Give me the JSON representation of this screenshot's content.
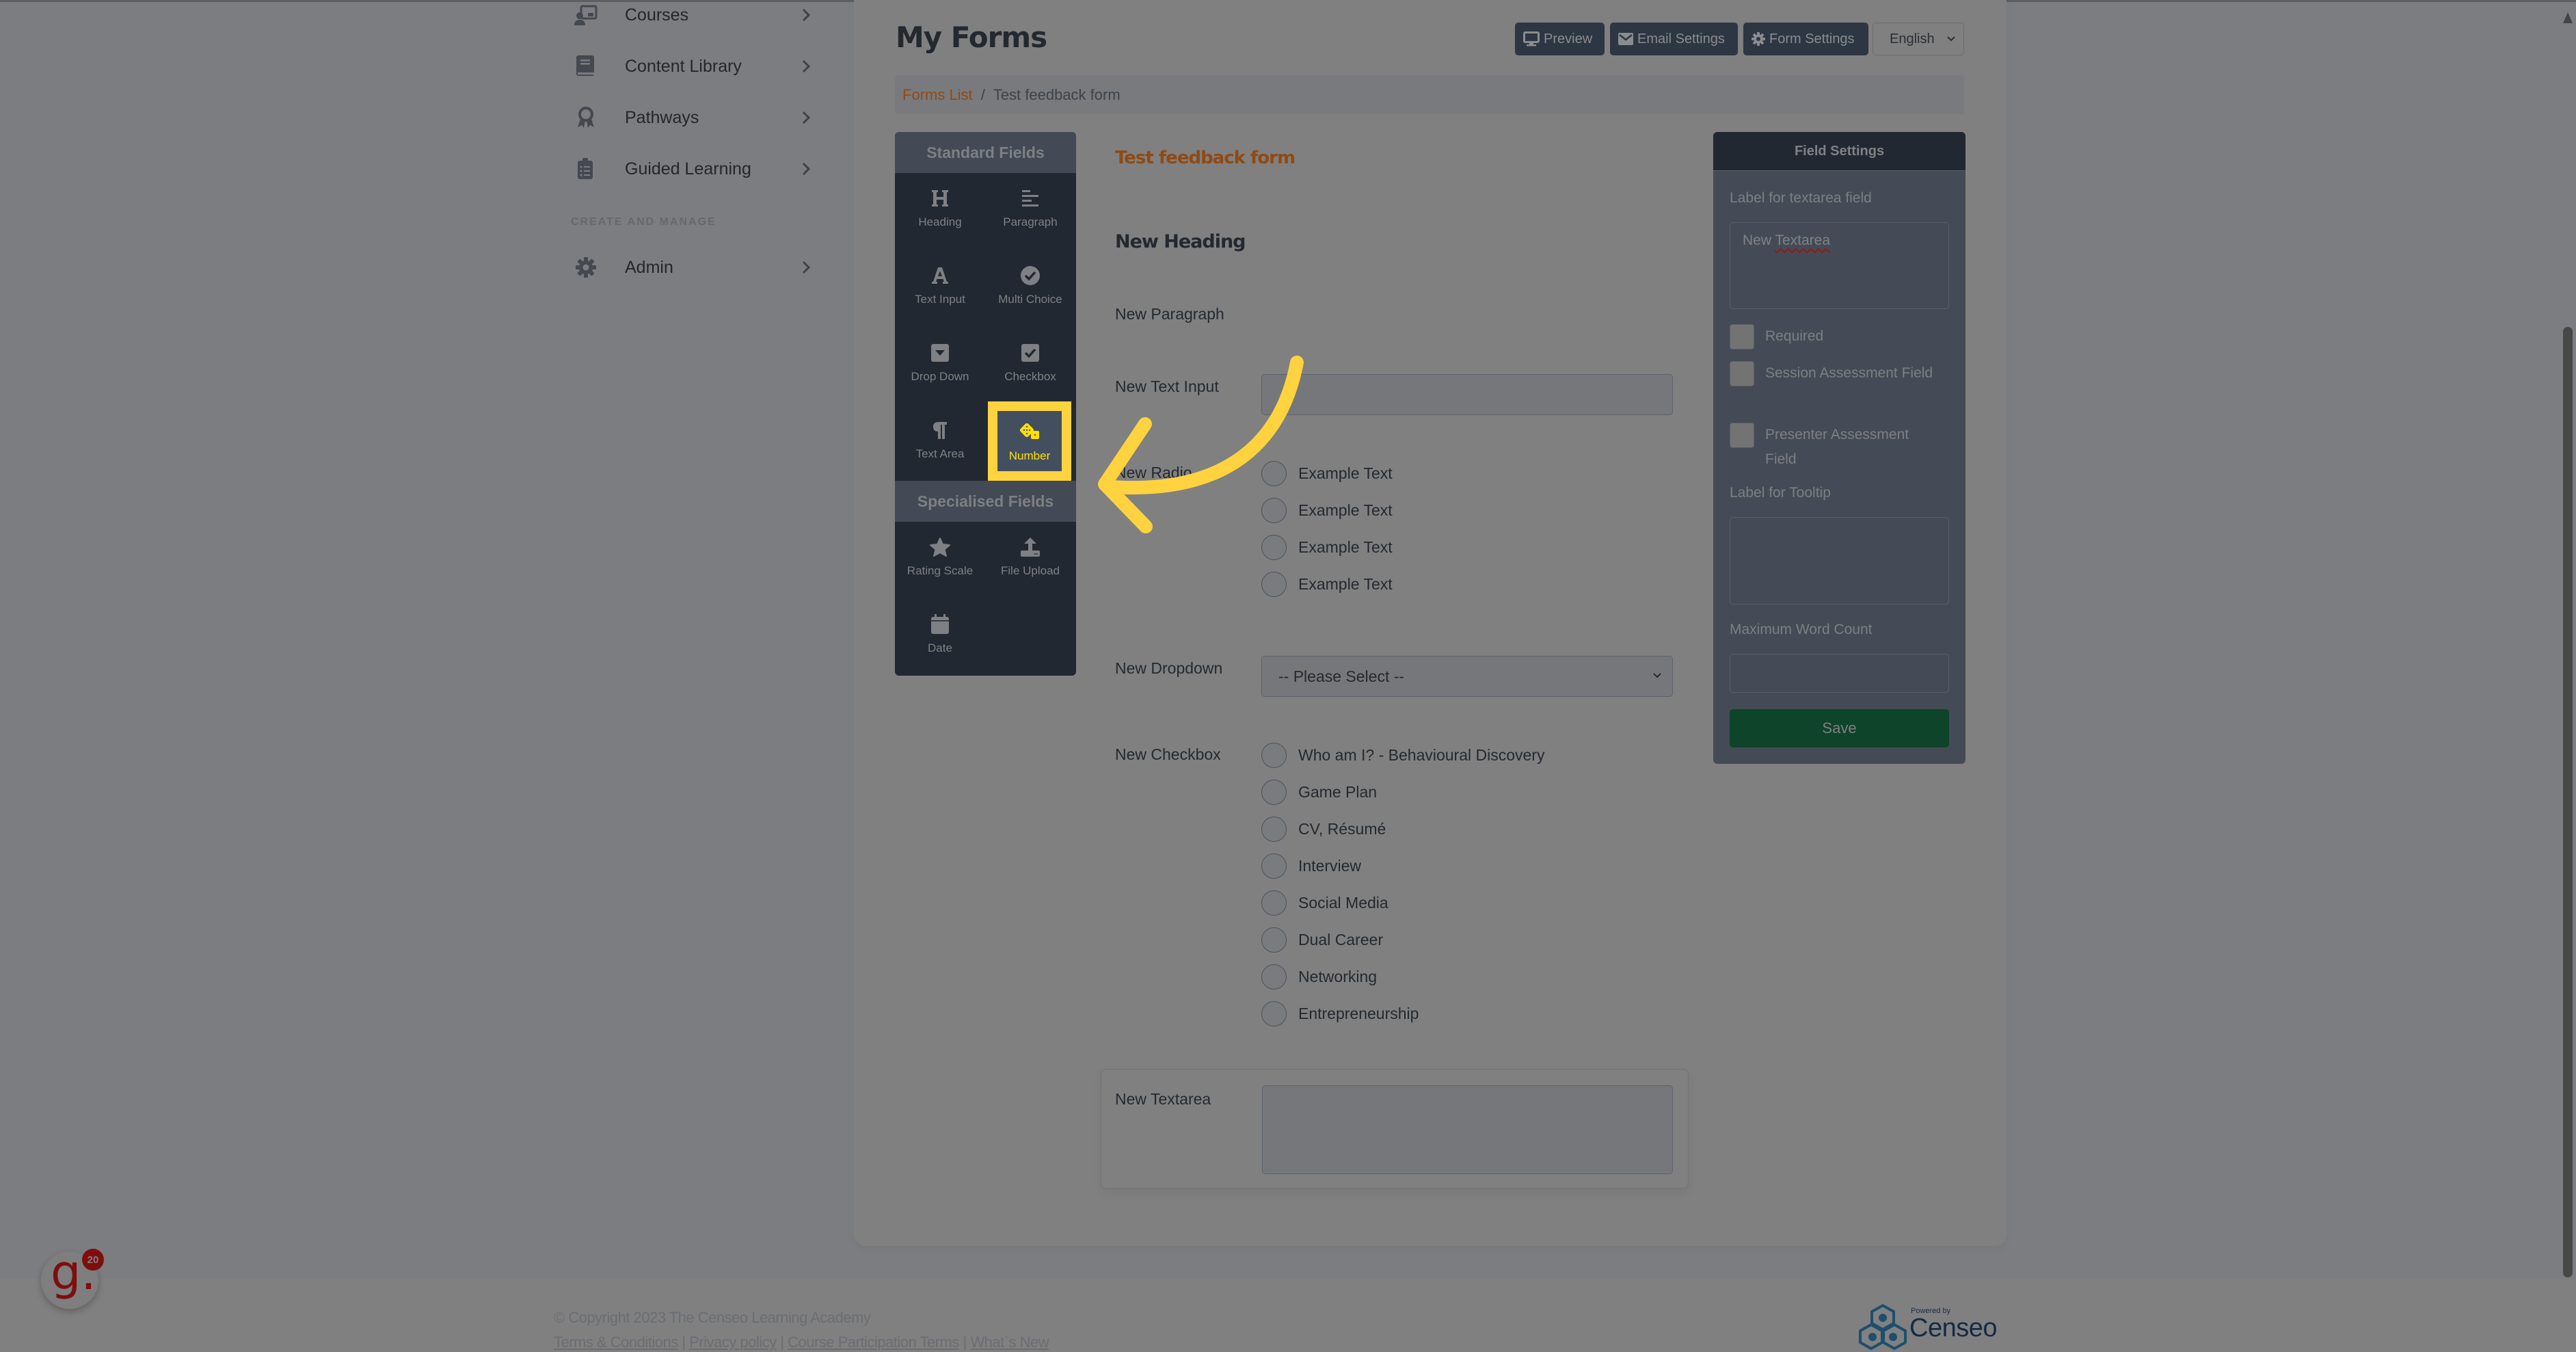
{
  "sidebar": {
    "items": [
      {
        "label": "Courses",
        "icon": "courses-icon"
      },
      {
        "label": "Content Library",
        "icon": "book-icon"
      },
      {
        "label": "Pathways",
        "icon": "award-icon"
      },
      {
        "label": "Guided Learning",
        "icon": "clipboard-list-icon"
      }
    ],
    "section_label": "CREATE AND MANAGE",
    "admin_label": "Admin"
  },
  "header": {
    "title": "My Forms",
    "buttons": {
      "preview": "Preview",
      "email_settings": "Email Settings",
      "form_settings": "Form Settings"
    },
    "language": "English"
  },
  "breadcrumb": {
    "parent": "Forms List",
    "separator": "/",
    "current": "Test feedback form"
  },
  "palette": {
    "standard_title": "Standard Fields",
    "standard": [
      {
        "label": "Heading",
        "icon": "heading-icon"
      },
      {
        "label": "Paragraph",
        "icon": "paragraph-align-icon"
      },
      {
        "label": "Text Input",
        "icon": "font-icon"
      },
      {
        "label": "Multi Choice",
        "icon": "check-circle-icon"
      },
      {
        "label": "Drop Down",
        "icon": "caret-square-down-icon"
      },
      {
        "label": "Checkbox",
        "icon": "check-square-icon"
      },
      {
        "label": "Text Area",
        "icon": "pilcrow-icon"
      },
      {
        "label": "Number",
        "icon": "dice-icon",
        "highlighted": true
      }
    ],
    "specialised_title": "Specialised Fields",
    "specialised": [
      {
        "label": "Rating Scale",
        "icon": "star-icon"
      },
      {
        "label": "File Upload",
        "icon": "upload-icon"
      },
      {
        "label": "Date",
        "icon": "calendar-icon"
      }
    ]
  },
  "form": {
    "title": "Test feedback form",
    "heading": "New Heading",
    "paragraph": "New Paragraph",
    "text_input_label": "New Text Input",
    "text_input_value": "",
    "radio_label": "New Radio",
    "radio_options": [
      "Example Text",
      "Example Text",
      "Example Text",
      "Example Text"
    ],
    "dropdown_label": "New Dropdown",
    "dropdown_value": "-- Please Select --",
    "checkbox_label": "New Checkbox",
    "checkbox_options": [
      "Who am I? - Behavioural Discovery",
      "Game Plan",
      "CV, Résumé",
      "Interview",
      "Social Media",
      "Dual Career",
      "Networking",
      "Entrepreneurship"
    ],
    "textarea_label": "New Textarea",
    "textarea_value": ""
  },
  "settings": {
    "title": "Field Settings",
    "label_field_label": "Label for textarea field",
    "label_value_word1": "New",
    "label_value_word2": "Textarea",
    "checks": [
      {
        "label": "Required",
        "checked": false
      },
      {
        "label": "Session Assessment Field",
        "checked": false
      },
      {
        "label": "Presenter Assessment Field",
        "checked": false
      }
    ],
    "tooltip_label": "Label for Tooltip",
    "tooltip_value": "",
    "max_words_label": "Maximum Word Count",
    "max_words_value": "",
    "save_label": "Save"
  },
  "footer": {
    "copyright": "© Copyright 2023 The Censeo Learning Academy",
    "links": [
      "Terms & Conditions",
      "Privacy policy",
      "Course Participation Terms",
      "What`s New"
    ],
    "link_separator": "|",
    "powered_by": "Powered by",
    "brand": "Censeo"
  },
  "widget": {
    "letter": "g.",
    "badge_count": "20"
  },
  "colors": {
    "accent_orange": "#8f4a14",
    "highlight_yellow": "#ffd240",
    "save_green": "#0e442a",
    "dark_panel": "#222831"
  }
}
